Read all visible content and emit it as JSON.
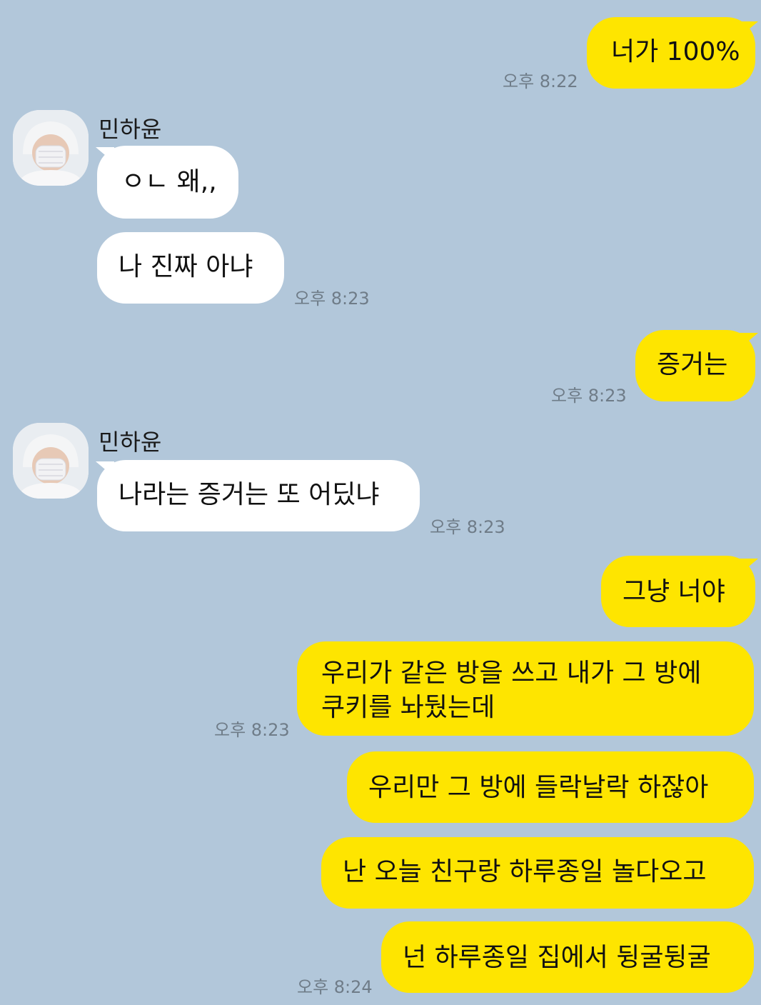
{
  "contact": {
    "name": "민하윤",
    "avatar_icon": "profile-photo-icon"
  },
  "colors": {
    "background": "#b2c7da",
    "my_bubble": "#fee500",
    "their_bubble": "#ffffff",
    "timestamp": "#6f7c88"
  },
  "messages": [
    {
      "from": "me",
      "text": "너가 100%",
      "time": "오후 8:22"
    },
    {
      "from": "them",
      "text": "ㅇㄴ 왜,,"
    },
    {
      "from": "them",
      "text": "나 진짜 아냐",
      "time": "오후 8:23"
    },
    {
      "from": "me",
      "text": "증거는",
      "time": "오후 8:23"
    },
    {
      "from": "them",
      "text": "나라는 증거는 또 어딨냐",
      "time": "오후 8:23"
    },
    {
      "from": "me",
      "text": "그냥 너야"
    },
    {
      "from": "me",
      "text_line1": "우리가 같은 방을 쓰고 내가 그 방에",
      "text_line2": "쿠키를 놔뒀는데",
      "time": "오후 8:23"
    },
    {
      "from": "me",
      "text": "우리만 그 방에 들락날락 하잖아"
    },
    {
      "from": "me",
      "text": "난 오늘 친구랑 하루종일 놀다오고"
    },
    {
      "from": "me",
      "text": "넌 하루종일 집에서 뒹굴뒹굴",
      "time": "오후 8:24"
    }
  ]
}
